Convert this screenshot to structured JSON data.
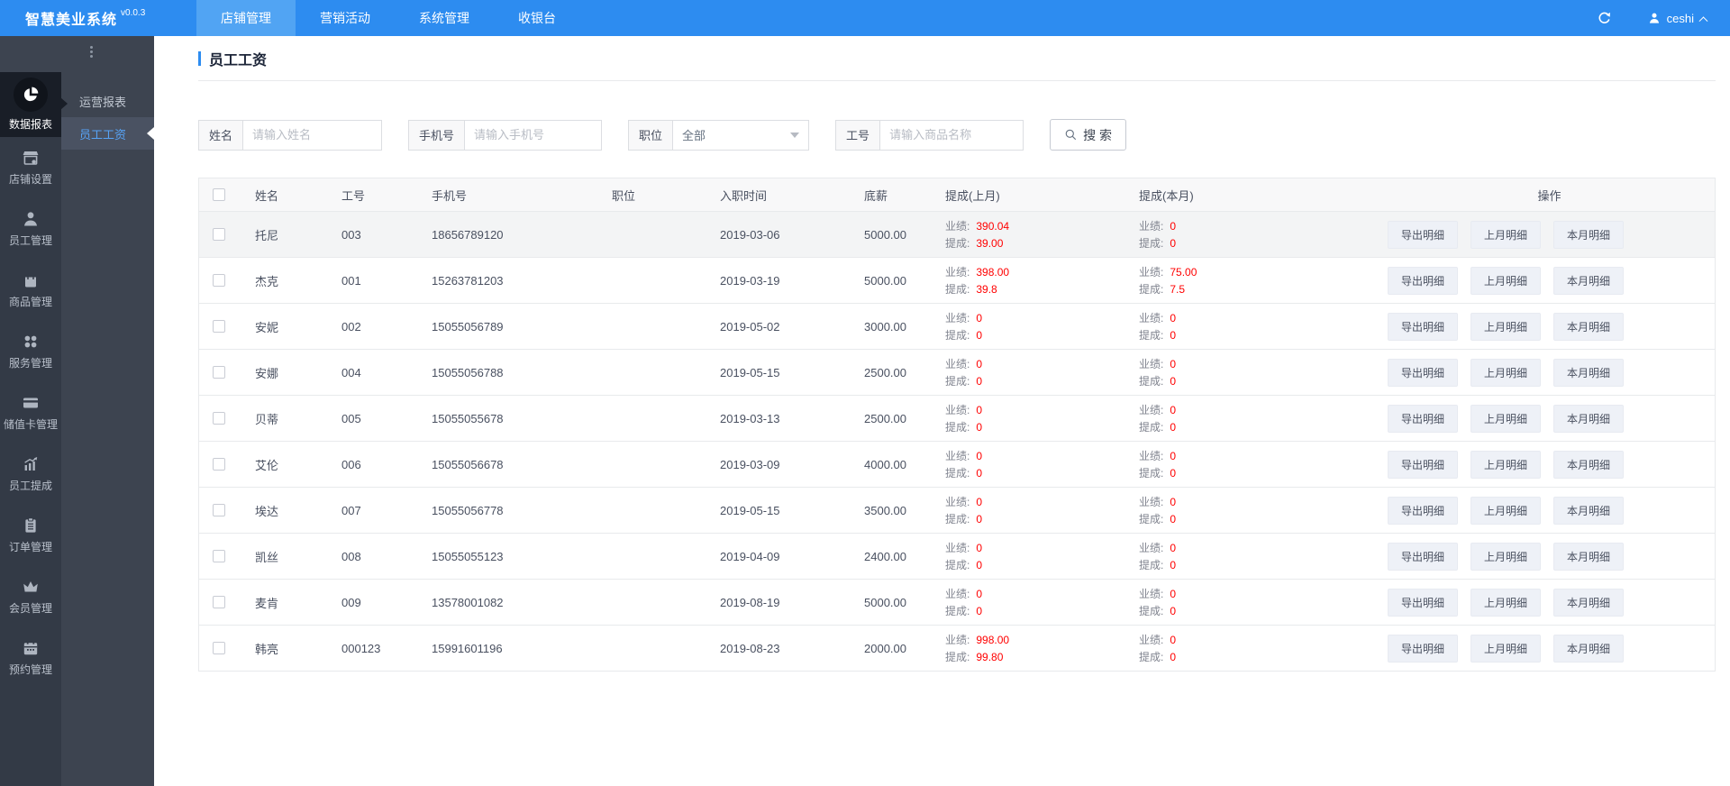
{
  "navbar": {
    "logo": "智慧美业系统",
    "version": "v0.0.3",
    "menu": [
      {
        "label": "店铺管理",
        "active": true
      },
      {
        "label": "营销活动",
        "active": false
      },
      {
        "label": "系统管理",
        "active": false
      },
      {
        "label": "收银台",
        "active": false
      }
    ],
    "user": "ceshi"
  },
  "sidebar": {
    "items": [
      {
        "label": "数据报表",
        "icon": "pie-chart-icon",
        "selected": true
      },
      {
        "label": "店铺设置",
        "icon": "storefront-icon",
        "selected": false
      },
      {
        "label": "员工管理",
        "icon": "employee-icon",
        "selected": false
      },
      {
        "label": "商品管理",
        "icon": "shopping-bag-icon",
        "selected": false
      },
      {
        "label": "服务管理",
        "icon": "services-icon",
        "selected": false
      },
      {
        "label": "储值卡管理",
        "icon": "credit-card-icon",
        "selected": false
      },
      {
        "label": "员工提成",
        "icon": "trend-chart-icon",
        "selected": false
      },
      {
        "label": "订单管理",
        "icon": "clipboard-icon",
        "selected": false
      },
      {
        "label": "会员管理",
        "icon": "crown-icon",
        "selected": false
      },
      {
        "label": "预约管理",
        "icon": "calendar-icon",
        "selected": false
      }
    ],
    "submenu": [
      {
        "label": "运营报表",
        "selected": false
      },
      {
        "label": "员工工资",
        "selected": true
      }
    ]
  },
  "page": {
    "title": "员工工资"
  },
  "filters": {
    "name_label": "姓名",
    "name_placeholder": "请输入姓名",
    "phone_label": "手机号",
    "phone_placeholder": "请输入手机号",
    "position_label": "职位",
    "position_value": "全部",
    "id_label": "工号",
    "id_placeholder": "请输入商品名称",
    "search_label": "搜 索"
  },
  "table": {
    "headers": [
      "姓名",
      "工号",
      "手机号",
      "职位",
      "入职时间",
      "底薪",
      "提成(上月)",
      "提成(本月)",
      "操作"
    ],
    "perf_label": "业绩:",
    "comm_label": "提成:",
    "actions": [
      "导出明细",
      "上月明细",
      "本月明细"
    ],
    "rows": [
      {
        "name": "托尼",
        "id": "003",
        "phone": "18656789120",
        "position": "",
        "hire_date": "2019-03-06",
        "salary": "5000.00",
        "last_perf": "390.04",
        "last_comm": "39.00",
        "cur_perf": "0",
        "cur_comm": "0",
        "highlighted": true
      },
      {
        "name": "杰克",
        "id": "001",
        "phone": "15263781203",
        "position": "",
        "hire_date": "2019-03-19",
        "salary": "5000.00",
        "last_perf": "398.00",
        "last_comm": "39.8",
        "cur_perf": "75.00",
        "cur_comm": "7.5",
        "highlighted": false
      },
      {
        "name": "安妮",
        "id": "002",
        "phone": "15055056789",
        "position": "",
        "hire_date": "2019-05-02",
        "salary": "3000.00",
        "last_perf": "0",
        "last_comm": "0",
        "cur_perf": "0",
        "cur_comm": "0",
        "highlighted": false
      },
      {
        "name": "安娜",
        "id": "004",
        "phone": "15055056788",
        "position": "",
        "hire_date": "2019-05-15",
        "salary": "2500.00",
        "last_perf": "0",
        "last_comm": "0",
        "cur_perf": "0",
        "cur_comm": "0",
        "highlighted": false
      },
      {
        "name": "贝蒂",
        "id": "005",
        "phone": "15055055678",
        "position": "",
        "hire_date": "2019-03-13",
        "salary": "2500.00",
        "last_perf": "0",
        "last_comm": "0",
        "cur_perf": "0",
        "cur_comm": "0",
        "highlighted": false
      },
      {
        "name": "艾伦",
        "id": "006",
        "phone": "15055056678",
        "position": "",
        "hire_date": "2019-03-09",
        "salary": "4000.00",
        "last_perf": "0",
        "last_comm": "0",
        "cur_perf": "0",
        "cur_comm": "0",
        "highlighted": false
      },
      {
        "name": "埃达",
        "id": "007",
        "phone": "15055056778",
        "position": "",
        "hire_date": "2019-05-15",
        "salary": "3500.00",
        "last_perf": "0",
        "last_comm": "0",
        "cur_perf": "0",
        "cur_comm": "0",
        "highlighted": false
      },
      {
        "name": "凯丝",
        "id": "008",
        "phone": "15055055123",
        "position": "",
        "hire_date": "2019-04-09",
        "salary": "2400.00",
        "last_perf": "0",
        "last_comm": "0",
        "cur_perf": "0",
        "cur_comm": "0",
        "highlighted": false
      },
      {
        "name": "麦肯",
        "id": "009",
        "phone": "13578001082",
        "position": "",
        "hire_date": "2019-08-19",
        "salary": "5000.00",
        "last_perf": "0",
        "last_comm": "0",
        "cur_perf": "0",
        "cur_comm": "0",
        "highlighted": false
      },
      {
        "name": "韩亮",
        "id": "000123",
        "phone": "15991601196",
        "position": "",
        "hire_date": "2019-08-23",
        "salary": "2000.00",
        "last_perf": "998.00",
        "last_comm": "99.80",
        "cur_perf": "0",
        "cur_comm": "0",
        "highlighted": false
      }
    ]
  },
  "colors": {
    "primary": "#2d8cf0",
    "navbar_active": "#51a4f3",
    "sidebar_bg": "#333a46",
    "sidebar_selected_bg": "#191e27",
    "submenu_bg": "#3d4450",
    "submenu_selected_text": "#57a3f5",
    "value_red": "#ff0000",
    "table_header_bg": "#f8f8f9"
  }
}
